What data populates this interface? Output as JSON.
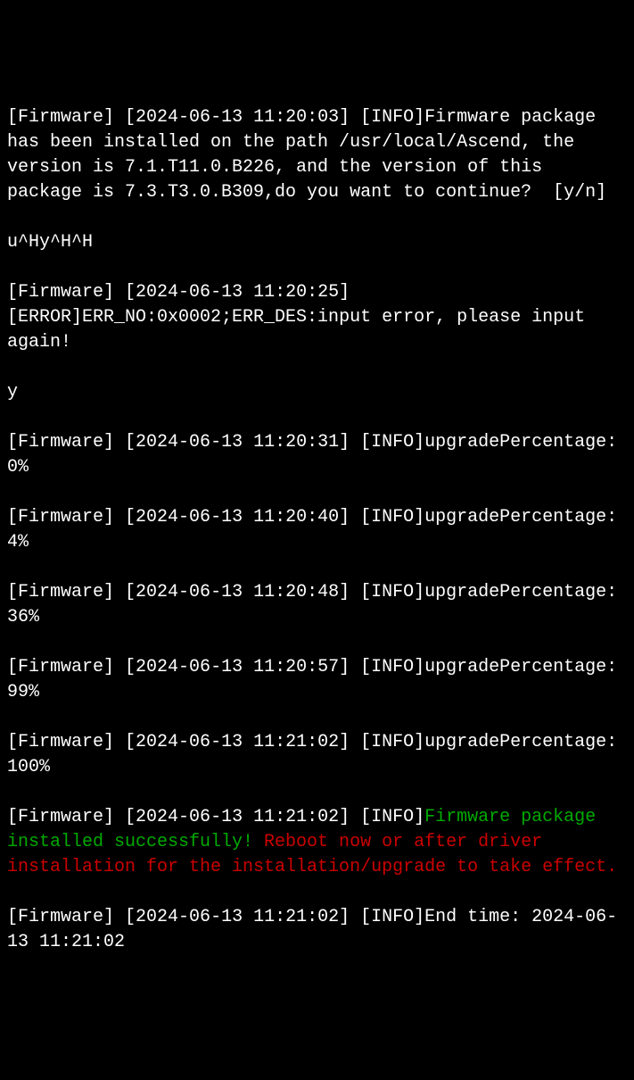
{
  "lines": [
    {
      "tag": "[Firmware]",
      "ts": "[2024-06-13 11:20:03]",
      "level": "[INFO]",
      "msg": "Firmware package has been installed on the path /usr/local/Ascend, the version is 7.1.T11.0.B226, and the version of this package is 7.3.T3.0.B309,do you want to continue?  [y/n]"
    },
    {
      "raw": "u^Hy^H^H"
    },
    {
      "tag": "[Firmware]",
      "ts": "[2024-06-13 11:20:25]",
      "level": "[ERROR]",
      "msg": "ERR_NO:0x0002;ERR_DES:input error, please input again!"
    },
    {
      "raw": "y"
    },
    {
      "tag": "[Firmware]",
      "ts": "[2024-06-13 11:20:31]",
      "level": "[INFO]",
      "msg": "upgradePercentage: 0%"
    },
    {
      "tag": "[Firmware]",
      "ts": "[2024-06-13 11:20:40]",
      "level": "[INFO]",
      "msg": "upgradePercentage: 4%"
    },
    {
      "tag": "[Firmware]",
      "ts": "[2024-06-13 11:20:48]",
      "level": "[INFO]",
      "msg": "upgradePercentage: 36%"
    },
    {
      "tag": "[Firmware]",
      "ts": "[2024-06-13 11:20:57]",
      "level": "[INFO]",
      "msg": "upgradePercentage: 99%"
    },
    {
      "tag": "[Firmware]",
      "ts": "[2024-06-13 11:21:02]",
      "level": "[INFO]",
      "msg": "upgradePercentage: 100%"
    },
    {
      "tag": "[Firmware]",
      "ts": "[2024-06-13 11:21:02]",
      "level": "[INFO]",
      "colored": true,
      "green_part": "Firmware package installed successfully! ",
      "red_part": "Reboot now or after driver installation for the installation/upgrade to take effect."
    },
    {
      "tag": "[Firmware]",
      "ts": "[2024-06-13 11:21:02]",
      "level": "[INFO]",
      "msg": "End time: 2024-06-13 11:21:02"
    }
  ]
}
